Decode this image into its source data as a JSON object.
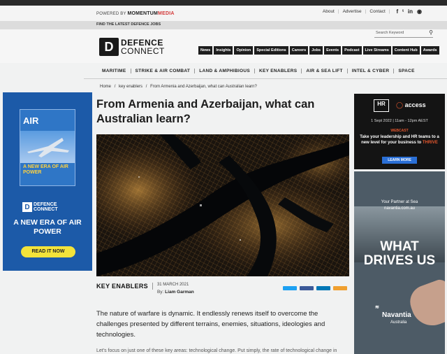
{
  "topbar": {
    "powered_by": "POWERED BY",
    "brand": "MOMENTUM",
    "brand_accent": "MEDIA",
    "links": [
      "About",
      "Advertise",
      "Contact"
    ],
    "social_icons": [
      "facebook-icon",
      "twitter-icon",
      "linkedin-icon",
      "instagram-icon"
    ]
  },
  "jobs_bar": "FIND THE LATEST DEFENCE JOBS",
  "logo": {
    "mark": "D",
    "line1": "DEFENCE",
    "line2": "CONNECT"
  },
  "search": {
    "placeholder": "Search Keyword"
  },
  "category_nav": [
    "News",
    "Insights",
    "Opinion",
    "Special Editions",
    "Careers",
    "Jobs",
    "Events",
    "Podcast",
    "Live Streams",
    "Content Hub",
    "Awards"
  ],
  "main_nav": [
    "MARITIME",
    "STRIKE & AIR COMBAT",
    "LAND & AMPHIBIOUS",
    "KEY ENABLERS",
    "AIR & SEA LIFT",
    "INTEL & CYBER",
    "SPACE"
  ],
  "breadcrumb": {
    "home": "Home",
    "sep": "/",
    "section": "key enablers",
    "current": "From Armenia and Azerbaijan, what can Australian learn?"
  },
  "article": {
    "title": "From Armenia and Azerbaijan, what can Australian learn?",
    "category": "KEY ENABLERS",
    "date": "31 MARCH 2021",
    "by_prefix": "By:",
    "author": "Liam Garman",
    "lead": "The nature of warfare is dynamic. It endlessly renews itself to overcome the challenges presented by different terrains, enemies, situations, ideologies and technologies.",
    "next": "Let's focus on just one of these key areas: technological change. Put simply, the rate of technological change in"
  },
  "share_colors": [
    "#1da1f2",
    "#3b5998",
    "#0077b5",
    "#f0a030"
  ],
  "ad_left": {
    "magazine_name": "AIR",
    "cover_text": "A NEW ERA OF AIR POWER",
    "logo_mark": "D",
    "logo_line1": "DEFENCE",
    "logo_line2": "CONNECT",
    "headline": "A NEW ERA OF AIR POWER",
    "button": "READ IT NOW"
  },
  "ad_right_top": {
    "hr": "HR",
    "access_prefix": "",
    "access": "access",
    "date": "1 Sept 2022 | 11am - 12pm AEST",
    "webcast": "WEBCAST",
    "text1": "Take your leadership and HR teams to a new level for your business to",
    "text_accent": "THRIVE",
    "button": "LEARN MORE"
  },
  "ad_right_bottom": {
    "partner": "Your Partner at Sea",
    "url": "navantia.com.au",
    "headline": "WHAT DRIVES US",
    "brand": "Navantia",
    "country": "Australia"
  }
}
